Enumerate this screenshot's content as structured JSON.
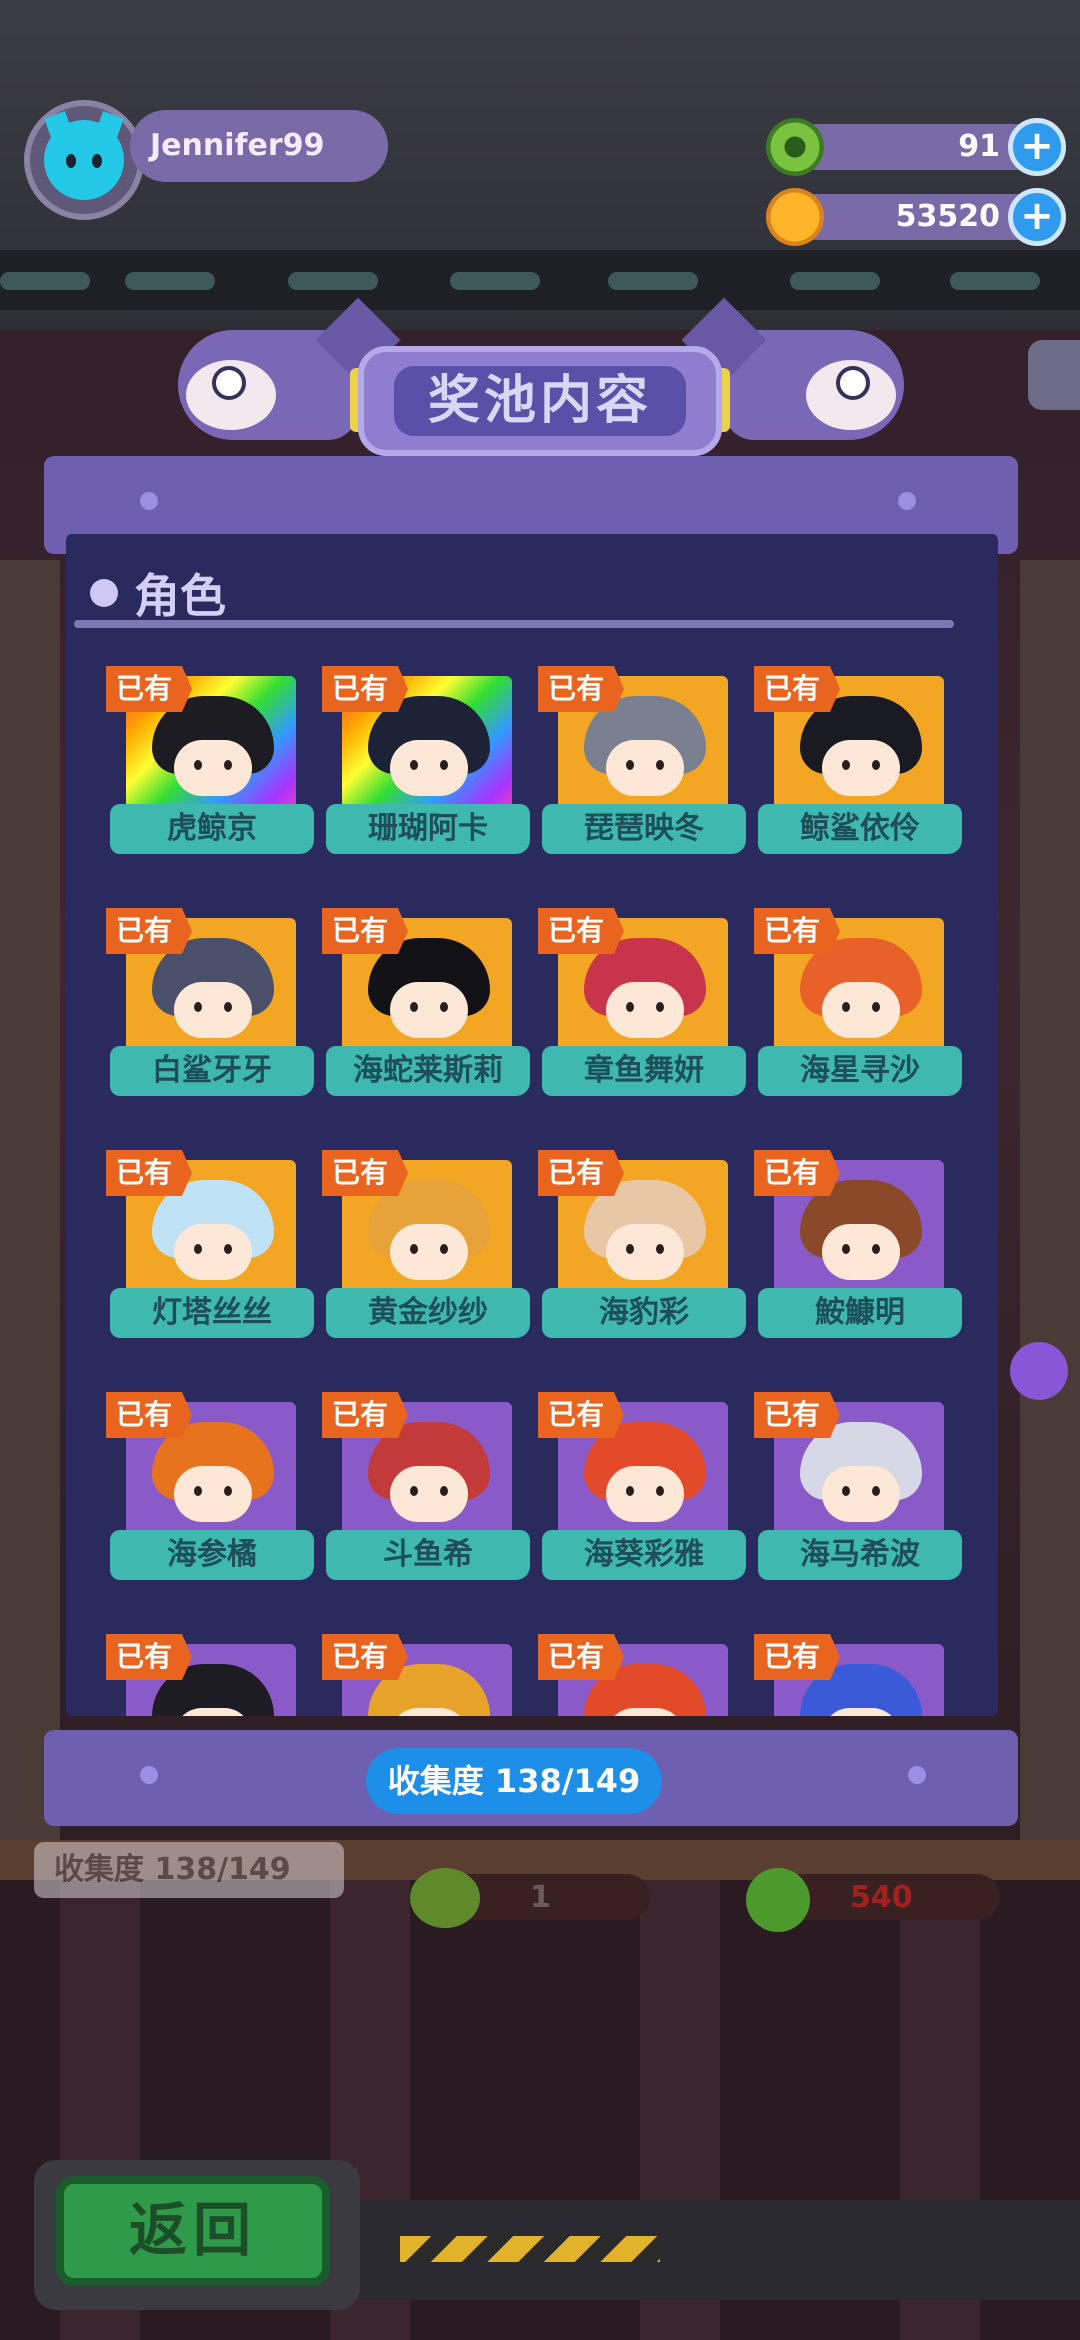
{
  "hud": {
    "username": "Jennifer99",
    "green_currency": "91",
    "gold_currency": "53520",
    "plus_symbol": "+"
  },
  "panel": {
    "title": "奖池内容",
    "section_label": "角色",
    "owned_badge": "已有",
    "progress_text": "收集度  138/149"
  },
  "characters": [
    {
      "name": "虎鲸京",
      "card": "rainbow",
      "hair": "#1c1c22"
    },
    {
      "name": "珊瑚阿卡",
      "card": "rainbow",
      "hair": "#1e2236"
    },
    {
      "name": "琵琶映冬",
      "card": "#f2a623",
      "hair": "#7a8090"
    },
    {
      "name": "鲸鲨依伶",
      "card": "#f2a623",
      "hair": "#1a1a22"
    },
    {
      "name": "白鲨牙牙",
      "card": "#f2a623",
      "hair": "#4a4f6a"
    },
    {
      "name": "海蛇莱斯莉",
      "card": "#f2a623",
      "hair": "#121216"
    },
    {
      "name": "章鱼舞妍",
      "card": "#f2a623",
      "hair": "#c8344a"
    },
    {
      "name": "海星寻沙",
      "card": "#f2a623",
      "hair": "#e8612a"
    },
    {
      "name": "灯塔丝丝",
      "card": "#f2a623",
      "hair": "#bfe2f6"
    },
    {
      "name": "黄金纱纱",
      "card": "#f2a623",
      "hair": "#e7a23a"
    },
    {
      "name": "海豹彩",
      "card": "#f2a623",
      "hair": "#e8c7a6"
    },
    {
      "name": "鮟鱇明",
      "card": "#8a5ac8",
      "hair": "#8a4a2a"
    },
    {
      "name": "海参橘",
      "card": "#8a5ac8",
      "hair": "#e8731e"
    },
    {
      "name": "斗鱼希",
      "card": "#8a5ac8",
      "hair": "#c23a3a"
    },
    {
      "name": "海葵彩雅",
      "card": "#8a5ac8",
      "hair": "#e24a2a"
    },
    {
      "name": "海马希波",
      "card": "#8a5ac8",
      "hair": "#d6d8e6"
    },
    {
      "name": "",
      "card": "#8a5ac8",
      "hair": "#1c1c22"
    },
    {
      "name": "",
      "card": "#8a5ac8",
      "hair": "#e8a42a"
    },
    {
      "name": "",
      "card": "#8a5ac8",
      "hair": "#e24a2a"
    },
    {
      "name": "",
      "card": "#8a5ac8",
      "hair": "#3a5ad8"
    }
  ],
  "background": {
    "collect_text": "收集度  138/149",
    "coin_count": "1",
    "coin_cost": "540"
  },
  "back_button": "返回",
  "colors": {
    "badge": "#e8641f",
    "name_tag": "#3fb8b0",
    "panel": "#2a2a5e",
    "progress": "#1d8fe8",
    "back": "#2f9a4a"
  }
}
